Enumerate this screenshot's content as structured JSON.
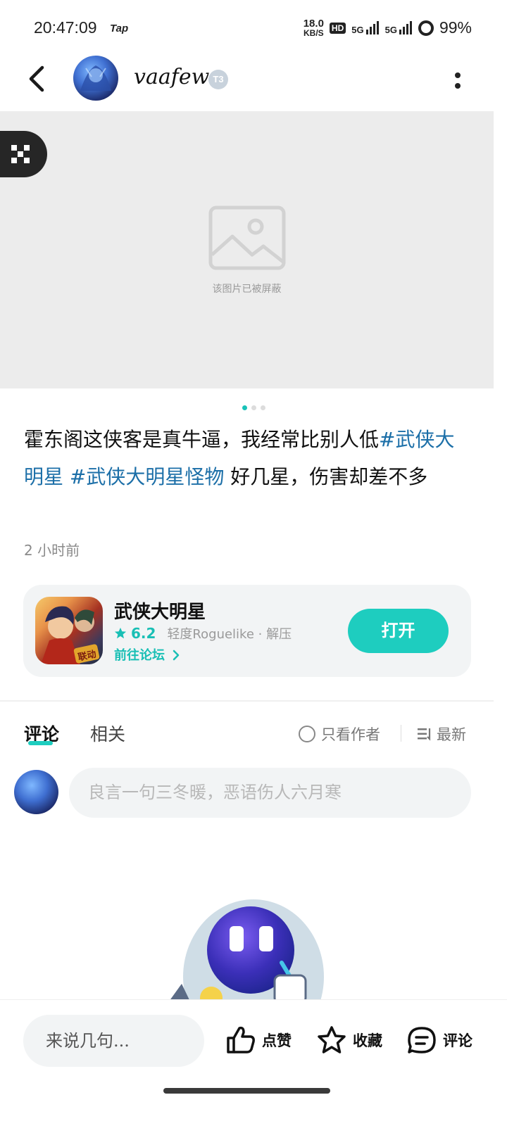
{
  "status_bar": {
    "time": "20:47:09",
    "app_badge": "Tap",
    "net_speed_value": "18.0",
    "net_speed_unit": "KB/S",
    "hd_badge": "HD",
    "signal_1": "5G",
    "signal_2": "5G",
    "battery": "99%"
  },
  "header": {
    "username": "vaafew",
    "level_badge": "T3",
    "back_icon": "chevron-left-icon",
    "more_icon": "more-vertical-icon"
  },
  "image": {
    "blocked_text": "该图片已被屏蔽",
    "qr_icon": "qr-code-icon",
    "page_count": 3,
    "active_page": 1
  },
  "post": {
    "text_plain_1": "霍东阁这侠客是真牛逼，我经常比别人低",
    "tag_1": "#武侠大明星",
    "tag_2": "#武侠大明星怪物",
    "text_plain_2": " 好几星，伤害却差不多",
    "time": "2 小时前"
  },
  "game_card": {
    "title": "武侠大明星",
    "rating": "6.2",
    "tags": "轻度Roguelike · 解压",
    "forum_link": "前往论坛",
    "open_button": "打开",
    "icon_badge": "联动"
  },
  "comments": {
    "tab_comments": "评论",
    "tab_related": "相关",
    "author_only": "只看作者",
    "sort_label": "最新",
    "input_placeholder": "良言一句三冬暖，恶语伤人六月寒"
  },
  "bottom_bar": {
    "say_placeholder": "来说几句...",
    "like_label": "点赞",
    "favorite_label": "收藏",
    "comment_label": "评论"
  },
  "colors": {
    "accent": "#1ecdbf",
    "tag_link": "#1c6fa8"
  }
}
